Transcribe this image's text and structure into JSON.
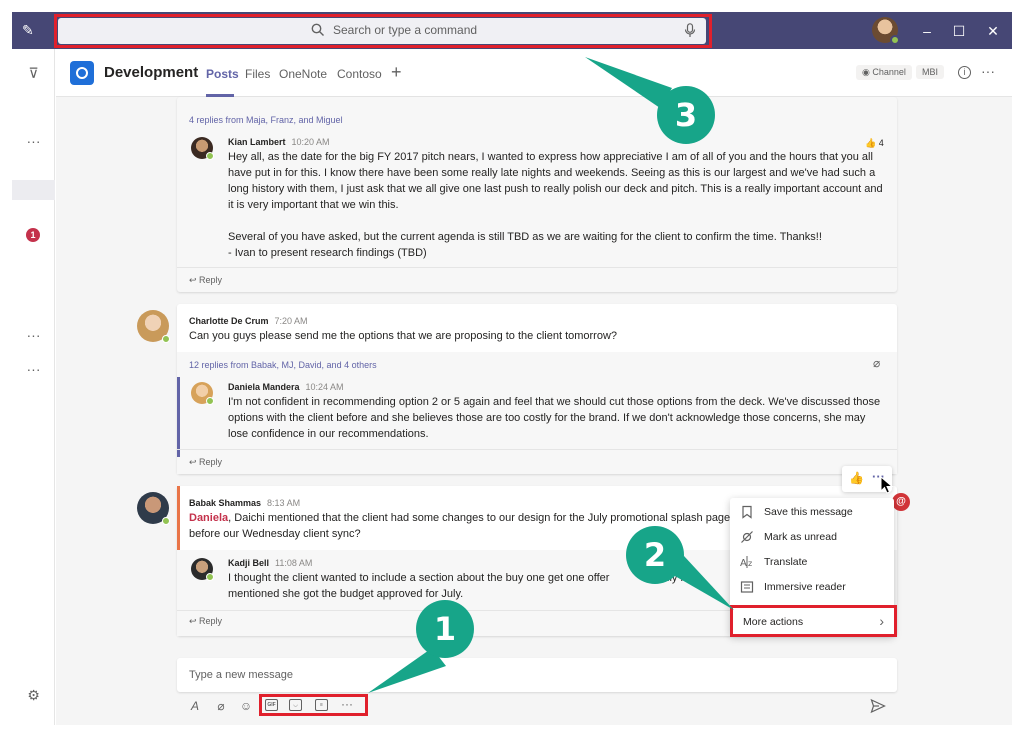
{
  "search": {
    "placeholder": "Search or type a command"
  },
  "header": {
    "team_name": "Development",
    "tabs": [
      "Posts",
      "Files",
      "OneNote",
      "Contoso"
    ],
    "channel_chip": "Channel",
    "mbi_chip": "MBI"
  },
  "rail": {
    "badge_count": "1"
  },
  "thread1": {
    "replies_summary": "4 replies from Maja, Franz, and Miguel",
    "author": "Kian Lambert",
    "time": "10:20 AM",
    "likes": "4",
    "text1": "Hey all, as the date for the big FY 2017 pitch nears, I wanted to express how appreciative I am of all of you and the hours that you all have put in for this. I know there have been some really late nights and weekends. Seeing as this is our largest and we've had such a long history with them, I just ask that we all give one last push to really polish our deck and pitch. This is a really important account and it is very important that we win this.",
    "text2": "Several of you have asked, but the current agenda is still TBD as we are waiting for the client to confirm the time. Thanks!!",
    "text3": "- Ivan to present research findings (TBD)",
    "reply_label": "Reply"
  },
  "thread2": {
    "author": "Charlotte De Crum",
    "time": "7:20 AM",
    "text": "Can you guys please send me the options that we are proposing to the client tomorrow?",
    "replies_summary": "12 replies from Babak, MJ, David, and 4 others",
    "reply_author": "Daniela Mandera",
    "reply_time": "10:24 AM",
    "reply_text": "I'm not confident in recommending option 2 or 5 again and feel that we should cut those options from the deck. We've discussed those options with the client before and she believes those are too costly for the brand. If we don't acknowledge those concerns, she may lose confidence in our recommendations.",
    "reply_label": "Reply"
  },
  "thread3": {
    "author": "Babak Shammas",
    "time": "8:13 AM",
    "mention": "Daniela",
    "text_after_mention": ", Daichi mentioned that the client had some changes to our design for the July promotional splash page",
    "text_line2": "before our Wednesday client sync?",
    "reply_author": "Kadji Bell",
    "reply_time": "11:08 AM",
    "reply_text_line1": "I thought the client wanted to include a section about the buy one get one offer as",
    "reply_text_line1b": "lly it w",
    "reply_text_line2": "mentioned she got the budget approved for July.",
    "reply_label": "Reply"
  },
  "context_menu": {
    "items": [
      "Save this message",
      "Mark as unread",
      "Translate",
      "Immersive reader"
    ],
    "more_actions": "More actions"
  },
  "compose": {
    "placeholder": "Type a new message"
  },
  "callouts": [
    "1",
    "2",
    "3"
  ],
  "colors": {
    "titlebar": "#464775",
    "accent": "#6264a7",
    "highlight": "#e0202c",
    "callout": "#17a589",
    "mention": "#c4314b"
  }
}
